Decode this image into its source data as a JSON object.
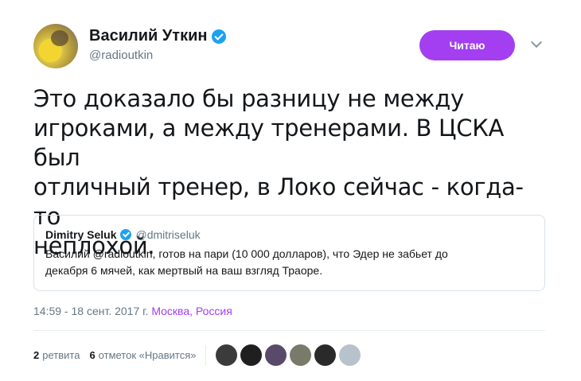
{
  "author": {
    "display_name": "Василий Уткин",
    "handle": "@radioutkin",
    "verified_icon": "verified-badge-icon"
  },
  "actions": {
    "follow_label": "Читаю"
  },
  "tweet": {
    "text": "Это доказало бы разницу не между\nигроками, а между тренерами. В ЦСКА был\nотличный тренер, в Локо сейчас - когда-то\nнеплохой."
  },
  "quoted": {
    "display_name": "Dimitry Seluk",
    "handle": "@dmitriseluk",
    "text": "Василий @radioutkin, готов на пари (10 000 долларов), что Эдер не забьет до\nдекабря 6 мячей, как мертвый на ваш взгляд Траоре."
  },
  "meta": {
    "timestamp": "14:59 - 18 сент. 2017 г.",
    "location": "Москва, Россия"
  },
  "stats": {
    "retweets_count": "2",
    "retweets_label": "ретвита",
    "likes_count": "6",
    "likes_label": "отметок «Нравится»"
  },
  "colors": {
    "accent": "#a33ff0",
    "verified": "#1da1f2"
  },
  "liker_avatars": [
    {
      "color": "#3b3b3b"
    },
    {
      "color": "#1f1f1f"
    },
    {
      "color": "#5a4a6a"
    },
    {
      "color": "#7a7a6a"
    },
    {
      "color": "#2a2a2a"
    },
    {
      "color": "#b8c2cc"
    }
  ]
}
